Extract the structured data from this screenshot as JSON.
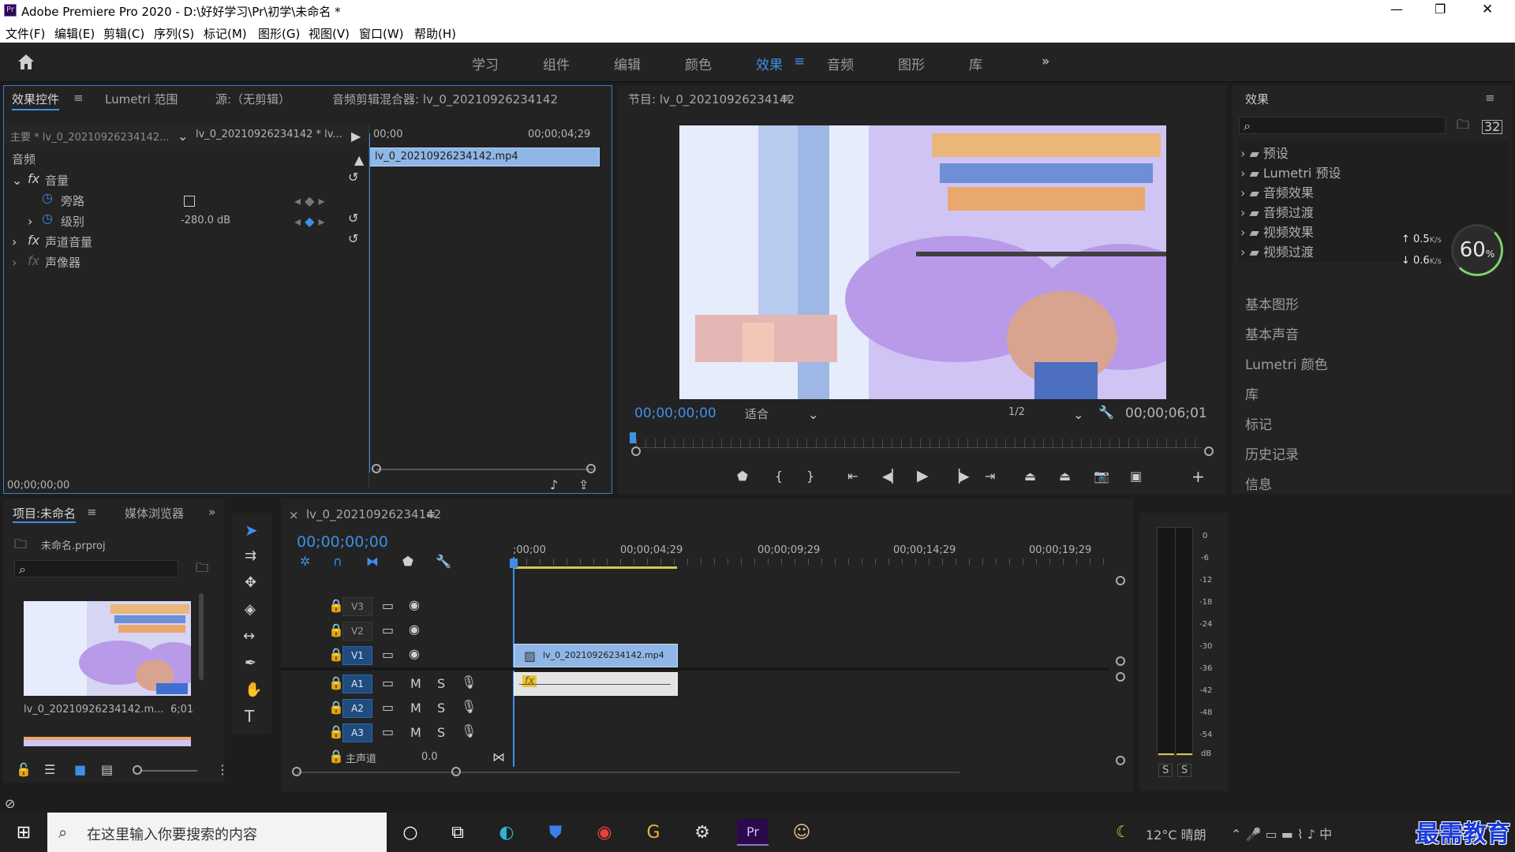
{
  "window": {
    "title": "Adobe Premiere Pro 2020 - D:\\好好学习\\Pr\\初学\\未命名 *",
    "controls": [
      "—",
      "❐",
      "✕"
    ]
  },
  "menu": [
    "文件(F)",
    "编辑(E)",
    "剪辑(C)",
    "序列(S)",
    "标记(M)",
    "图形(G)",
    "视图(V)",
    "窗口(W)",
    "帮助(H)"
  ],
  "workspaces": {
    "tabs": [
      "学习",
      "组件",
      "编辑",
      "颜色",
      "效果",
      "音频",
      "图形",
      "库"
    ],
    "active": "效果",
    "more": "»"
  },
  "effect_controls": {
    "tabs": [
      "效果控件",
      "Lumetri 范围",
      "源:（无剪辑）",
      "音频剪辑混合器: lv_0_20210926234142"
    ],
    "master": "主要 * lv_0_20210926234142...",
    "clip": "lv_0_20210926234142 * lv...",
    "time_start": "00;00",
    "time_end": "00;00;04;29",
    "clip_bar": "lv_0_20210926234142.mp4",
    "section": "音频",
    "rows": [
      "音量",
      "旁路",
      "级别",
      "声道音量",
      "声像器"
    ],
    "level_value": "-280.0 dB",
    "timecode": "00;00;00;00"
  },
  "program_monitor": {
    "title": "节目: lv_0_20210926234142",
    "timecode": "00;00;00;00",
    "fit": "适合",
    "resolution": "1/2",
    "duration": "00;00;06;01"
  },
  "effects_panel": {
    "title": "效果",
    "folders": [
      "预设",
      "Lumetri 预设",
      "音频效果",
      "音频过渡",
      "视频效果",
      "视频过渡"
    ],
    "sections": [
      "基本图形",
      "基本声音",
      "Lumetri 颜色",
      "库",
      "标记",
      "历史记录",
      "信息"
    ],
    "net_up": "0.5",
    "net_down": "0.6",
    "net_unit": "K/s",
    "cpu": "60",
    "cpu_unit": "%"
  },
  "project": {
    "tabs": [
      "项目:未命名",
      "媒体浏览器"
    ],
    "file": "未命名.prproj",
    "clip_name": "lv_0_20210926234142.m...",
    "clip_duration": "6;01"
  },
  "timeline": {
    "sequence": "lv_0_20210926234142",
    "timecode": "00;00;00;00",
    "ruler": [
      ";00;00",
      "00;00;04;29",
      "00;00;09;29",
      "00;00;14;29",
      "00;00;19;29"
    ],
    "video_tracks": [
      "V3",
      "V2",
      "V1"
    ],
    "audio_tracks": [
      "A1",
      "A2",
      "A3"
    ],
    "master": "主声道",
    "master_value": "0.0",
    "clip": "lv_0_20210926234142.mp4",
    "fx": "fx",
    "m": "M",
    "s": "S"
  },
  "meter": {
    "scale": [
      "0",
      "-6",
      "-12",
      "-18",
      "-24",
      "-30",
      "-36",
      "-42",
      "-48",
      "-54",
      "dB"
    ],
    "solo": [
      "S",
      "S"
    ]
  },
  "taskbar": {
    "search": "在这里输入你要搜索的内容",
    "weather": "12°C 晴朗",
    "watermark": "最需教育"
  }
}
